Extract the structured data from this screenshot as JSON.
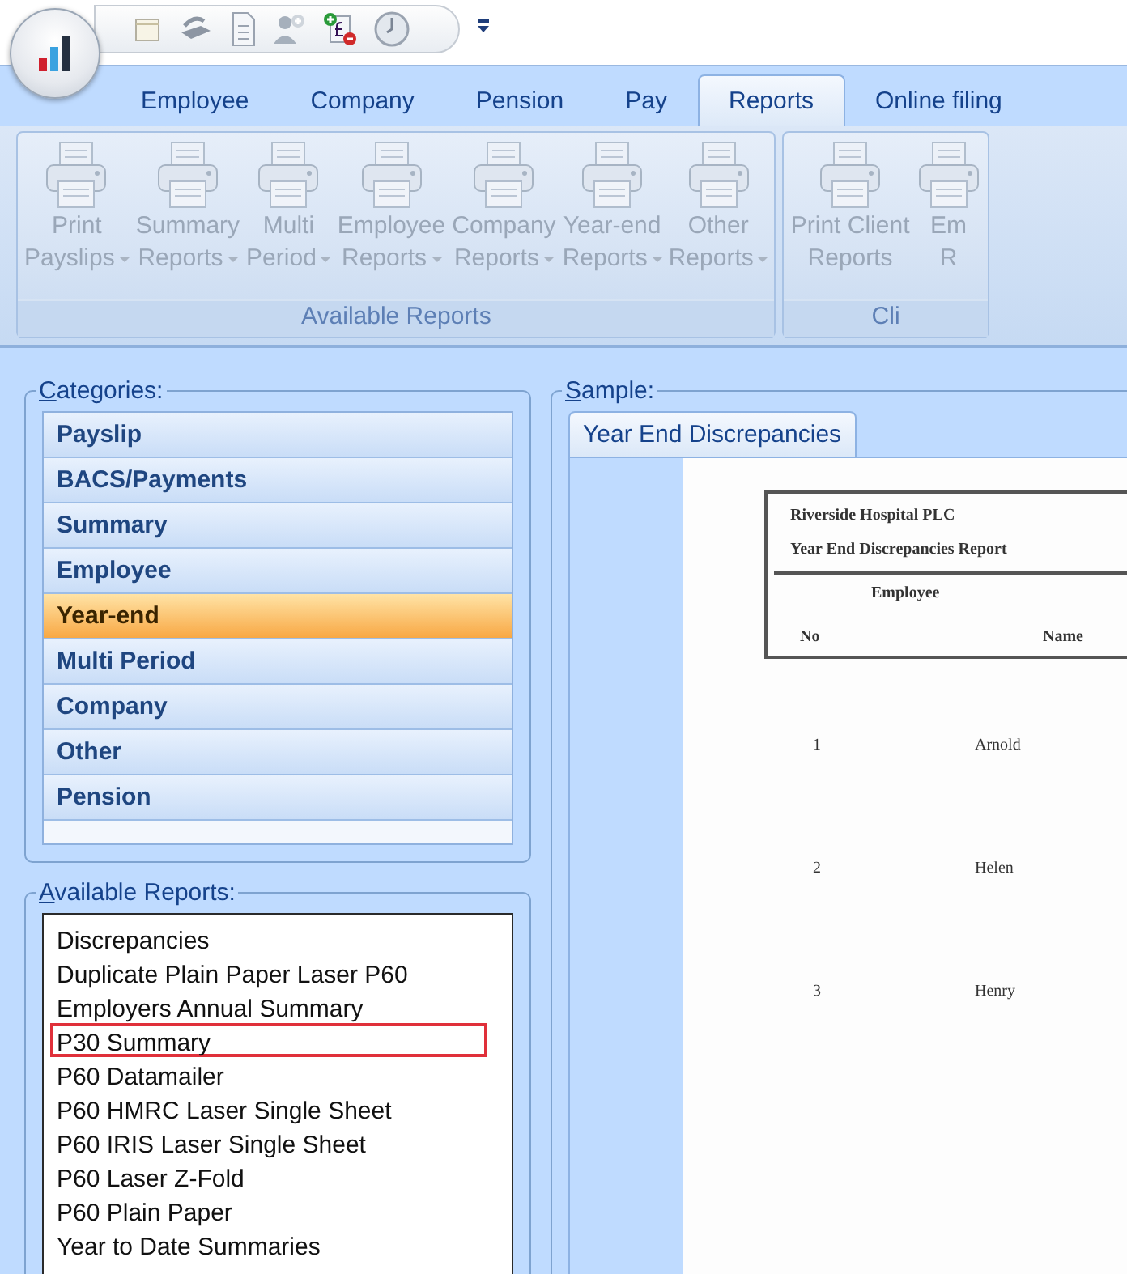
{
  "tabs": [
    {
      "label": "Employee",
      "selected": false
    },
    {
      "label": "Company",
      "selected": false
    },
    {
      "label": "Pension",
      "selected": false
    },
    {
      "label": "Pay",
      "selected": false
    },
    {
      "label": "Reports",
      "selected": true
    },
    {
      "label": "Online filing",
      "selected": false
    }
  ],
  "ribbon_groups": [
    {
      "label": "Available Reports",
      "buttons": [
        {
          "line1": "Print",
          "line2": "Payslips",
          "dropdown": true,
          "disabled": true
        },
        {
          "line1": "Summary",
          "line2": "Reports",
          "dropdown": true,
          "disabled": true
        },
        {
          "line1": "Multi",
          "line2": "Period",
          "dropdown": true,
          "disabled": true
        },
        {
          "line1": "Employee",
          "line2": "Reports",
          "dropdown": true,
          "disabled": true
        },
        {
          "line1": "Company",
          "line2": "Reports",
          "dropdown": true,
          "disabled": true
        },
        {
          "line1": "Year-end",
          "line2": "Reports",
          "dropdown": true,
          "disabled": true
        },
        {
          "line1": "Other",
          "line2": "Reports",
          "dropdown": true,
          "disabled": true
        }
      ]
    },
    {
      "label": "Cli",
      "buttons": [
        {
          "line1": "Print Client",
          "line2": "Reports",
          "dropdown": false,
          "disabled": true
        },
        {
          "line1": "Em",
          "line2": "R",
          "dropdown": false,
          "disabled": true
        }
      ]
    }
  ],
  "categories": {
    "title": "Categories:",
    "items": [
      {
        "label": "Payslip",
        "selected": false
      },
      {
        "label": "BACS/Payments",
        "selected": false
      },
      {
        "label": "Summary",
        "selected": false
      },
      {
        "label": "Employee",
        "selected": false
      },
      {
        "label": "Year-end",
        "selected": true
      },
      {
        "label": "Multi Period",
        "selected": false
      },
      {
        "label": "Company",
        "selected": false
      },
      {
        "label": "Other",
        "selected": false
      },
      {
        "label": "Pension",
        "selected": false
      }
    ]
  },
  "available_reports": {
    "title": "Available Reports:",
    "items": [
      {
        "label": "Discrepancies",
        "highlighted": false
      },
      {
        "label": "Duplicate Plain Paper Laser P60",
        "highlighted": false
      },
      {
        "label": "Employers Annual Summary",
        "highlighted": false
      },
      {
        "label": "P30 Summary",
        "highlighted": true
      },
      {
        "label": "P60 Datamailer",
        "highlighted": false
      },
      {
        "label": "P60 HMRC Laser Single Sheet",
        "highlighted": false
      },
      {
        "label": "P60 IRIS Laser Single Sheet",
        "highlighted": false
      },
      {
        "label": "P60 Laser Z-Fold",
        "highlighted": false
      },
      {
        "label": "P60 Plain Paper",
        "highlighted": false
      },
      {
        "label": "Year to Date Summaries",
        "highlighted": false
      }
    ]
  },
  "sample": {
    "title": "Sample:",
    "tab": "Year End Discrepancies",
    "report": {
      "company": "Riverside Hospital PLC",
      "title": "Year End Discrepancies Report",
      "group_heading": "Employee",
      "columns": [
        "No",
        "Name"
      ],
      "rows": [
        {
          "no": "1",
          "name": "Arnold"
        },
        {
          "no": "2",
          "name": "Helen"
        },
        {
          "no": "3",
          "name": "Henry"
        }
      ]
    }
  }
}
